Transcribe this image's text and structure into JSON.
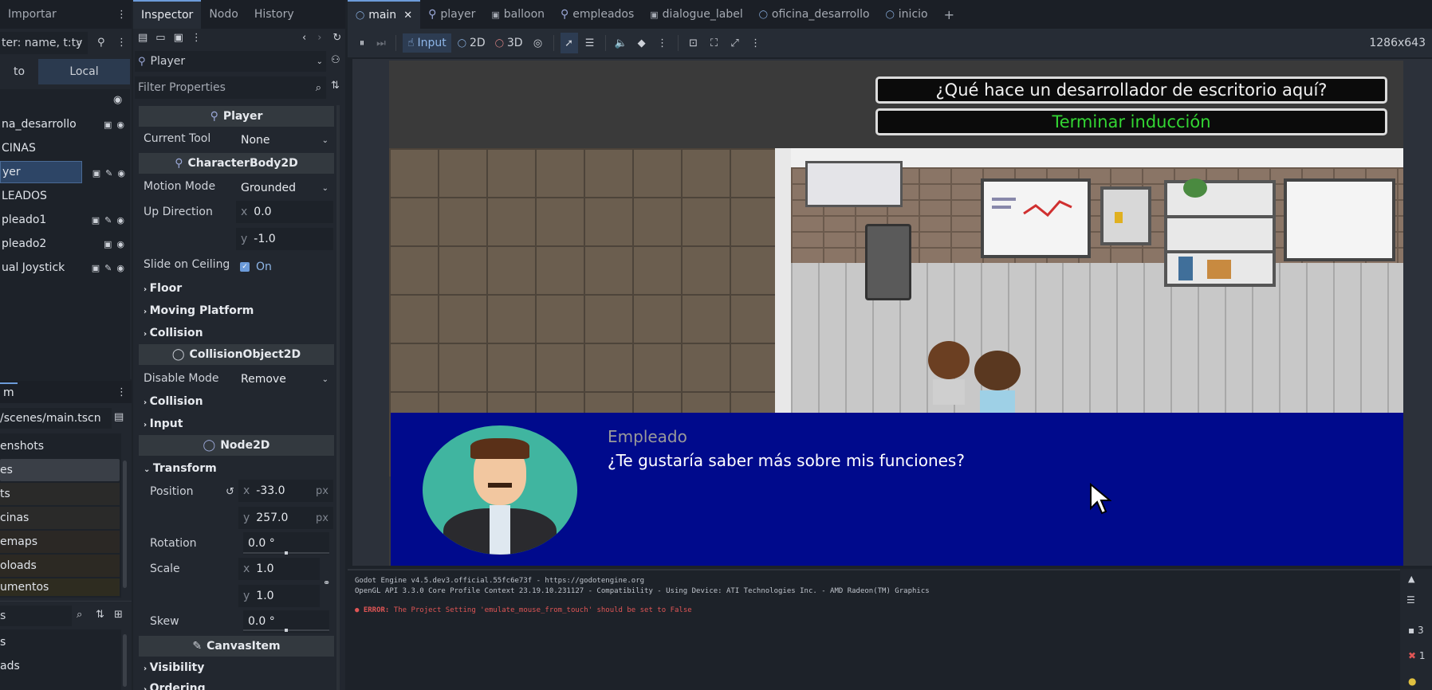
{
  "colors": {
    "accent": "#6c9bd9",
    "dialog_bg": "#000a8c",
    "option_highlight": "#33d633",
    "error_red": "#e05555"
  },
  "scene_dock": {
    "tab_label": "Importar",
    "filter_placeholder": "ter: name, t:ty",
    "mode_left": "to",
    "mode_right": "Local",
    "nodes": [
      {
        "label": "na_desarrollo"
      },
      {
        "label": "CINAS"
      },
      {
        "label": "yer"
      },
      {
        "label": "LEADOS"
      },
      {
        "label": "pleado1"
      },
      {
        "label": "pleado2"
      },
      {
        "label": "ual Joystick"
      }
    ]
  },
  "filesystem": {
    "tab_label": "m",
    "path": "/scenes/main.tscn",
    "items": [
      {
        "label": "enshots"
      },
      {
        "label": "es"
      },
      {
        "label": "ts"
      },
      {
        "label": "cinas"
      },
      {
        "label": "emaps"
      },
      {
        "label": "oloads"
      },
      {
        "label": "umentos"
      }
    ],
    "bottom_filter_label": "s",
    "bottom_items": [
      {
        "label": "s"
      },
      {
        "label": "ads"
      }
    ]
  },
  "inspector": {
    "tabs": [
      "Inspector",
      "Nodo",
      "History"
    ],
    "object_name": "Player",
    "filter_placeholder": "Filter Properties",
    "sections": {
      "player": "Player",
      "characterbody": "CharacterBody2D",
      "collisionobject": "CollisionObject2D",
      "node2d": "Node2D",
      "canvasitem": "CanvasItem"
    },
    "current_tool_label": "Current Tool",
    "current_tool_value": "None",
    "motion_mode_label": "Motion Mode",
    "motion_mode_value": "Grounded",
    "up_direction_label": "Up Direction",
    "up_x": "0.0",
    "up_y": "-1.0",
    "slide_label": "Slide on Ceiling",
    "slide_value": "On",
    "floor": "Floor",
    "moving_platform": "Moving Platform",
    "collision": "Collision",
    "disable_mode_label": "Disable Mode",
    "disable_mode_value": "Remove",
    "collision2": "Collision",
    "input": "Input",
    "transform": "Transform",
    "position_label": "Position",
    "pos_x": "-33.0",
    "pos_y": "257.0",
    "unit_px": "px",
    "rotation_label": "Rotation",
    "rotation_value": "0.0 °",
    "scale_label": "Scale",
    "scale_x": "1.0",
    "scale_y": "1.0",
    "skew_label": "Skew",
    "skew_value": "0.0 °",
    "visibility": "Visibility",
    "ordering": "Ordering",
    "axis_x": "x",
    "axis_y": "y"
  },
  "editor_tabs": [
    {
      "label": "main",
      "icon": "circle"
    },
    {
      "label": "player",
      "icon": "person"
    },
    {
      "label": "balloon",
      "icon": "film"
    },
    {
      "label": "empleados",
      "icon": "person"
    },
    {
      "label": "dialogue_label",
      "icon": "film"
    },
    {
      "label": "oficina_desarrollo",
      "icon": "circle"
    },
    {
      "label": "inicio",
      "icon": "circle"
    }
  ],
  "toolbar": {
    "input_label": "Input",
    "mode_2d": "2D",
    "mode_3d": "3D",
    "resolution": "1286x643"
  },
  "game": {
    "option1": "¿Qué hace un desarrollador de escritorio aquí?",
    "option2": "Terminar inducción",
    "speaker": "Empleado",
    "dialogue": "¿Te gustaría saber más sobre mis funciones?"
  },
  "console": {
    "line1": "Godot Engine v4.5.dev3.official.55fc6e73f - https://godotengine.org",
    "line2": "OpenGL API 3.3.0 Core Profile Context 23.19.10.231127 - Compatibility - Using Device: ATI Technologies Inc. - AMD Radeon(TM) Graphics",
    "error_prefix": "ERROR:",
    "error_text": "The Project Setting 'emulate_mouse_from_touch' should be set to False",
    "count_warn": "3",
    "count_err": "1"
  }
}
